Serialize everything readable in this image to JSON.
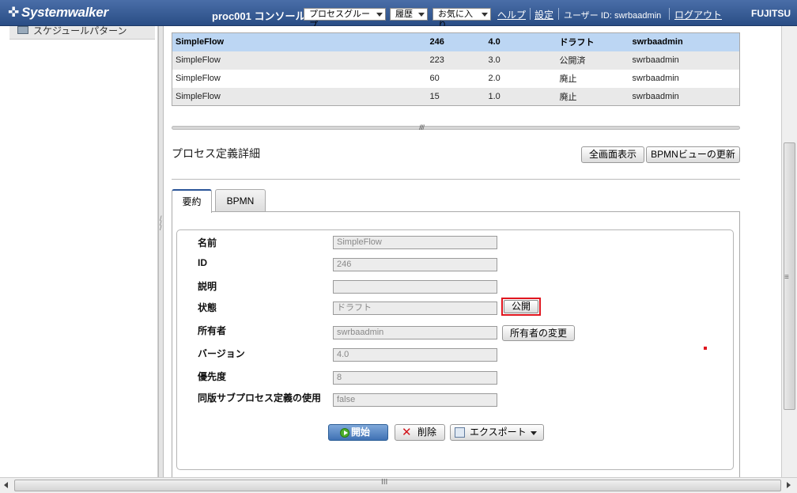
{
  "header": {
    "logo": "Systemwalker",
    "console_title": "proc001 コンソール",
    "dropdowns": [
      "プロセスグループ",
      "履歴",
      "お気に入り"
    ],
    "help_link": "ヘルプ",
    "settings_link": "設定",
    "user_label": "ユーザー ID: swrbaadmin",
    "logout_link": "ログアウト",
    "brand": "FUJITSU"
  },
  "sidebar": {
    "items": [
      {
        "label": "スケジュールパターン"
      }
    ]
  },
  "version_table": {
    "rows": [
      {
        "name": "SimpleFlow",
        "id": "246",
        "version": "4.0",
        "status": "ドラフト",
        "owner": "swrbaadmin"
      },
      {
        "name": "SimpleFlow",
        "id": "223",
        "version": "3.0",
        "status": "公開済",
        "owner": "swrbaadmin"
      },
      {
        "name": "SimpleFlow",
        "id": "60",
        "version": "2.0",
        "status": "廃止",
        "owner": "swrbaadmin"
      },
      {
        "name": "SimpleFlow",
        "id": "15",
        "version": "1.0",
        "status": "廃止",
        "owner": "swrbaadmin"
      }
    ]
  },
  "detail": {
    "title": "プロセス定義詳細",
    "fullscreen_button": "全画面表示",
    "refresh_bpmn_button": "BPMNビューの更新",
    "tabs": [
      {
        "label": "要約"
      },
      {
        "label": "BPMN"
      }
    ],
    "fields": [
      {
        "label": "名前",
        "value": "SimpleFlow"
      },
      {
        "label": "ID",
        "value": "246"
      },
      {
        "label": "説明",
        "value": ""
      },
      {
        "label": "状態",
        "value": "ドラフト"
      },
      {
        "label": "所有者",
        "value": "swrbaadmin"
      },
      {
        "label": "バージョン",
        "value": "4.0"
      },
      {
        "label": "優先度",
        "value": "8"
      },
      {
        "label": "同版サブプロセス定義の使用",
        "value": "false"
      }
    ],
    "publish_button": "公開",
    "change_owner_button": "所有者の変更",
    "start_button": "開始",
    "delete_button": "削除",
    "export_button": "エクスポート"
  },
  "colors": {
    "header_bg": "#2a4d85",
    "selected_row": "#bcd6f3",
    "highlight_border": "#e0161f",
    "primary_button": "#3f71b4"
  }
}
